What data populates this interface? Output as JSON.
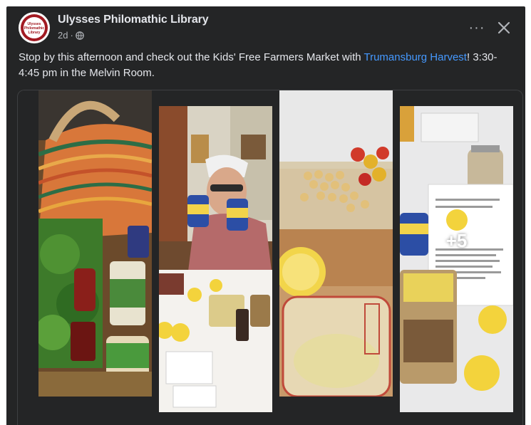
{
  "post": {
    "page_name": "Ulysses Philomathic Library",
    "avatar_text": [
      "Ulysses",
      "Philomathic",
      "Library"
    ],
    "timestamp": "2d",
    "audience_icon": "globe-icon",
    "more_icon": "more-dots-icon",
    "more_label": "···",
    "close_icon": "close-icon",
    "text_before_link": "Stop by this afternoon and check out the Kids' Free Farmers Market with ",
    "link_text": "Trumansburg Harvest",
    "text_after_link": "! 3:30-4:45 pm in the Melvin Room."
  },
  "gallery": {
    "photos": [
      {
        "description": "basket-of-groceries"
      },
      {
        "description": "woman-holding-cans"
      },
      {
        "description": "chickpeas-and-lemons"
      },
      {
        "description": "ingredients-and-recipe"
      }
    ],
    "more_count": "+5"
  },
  "colors": {
    "card_bg": "#242526",
    "text_primary": "#e4e6eb",
    "text_secondary": "#b0b3b8",
    "link": "#4599ff"
  }
}
